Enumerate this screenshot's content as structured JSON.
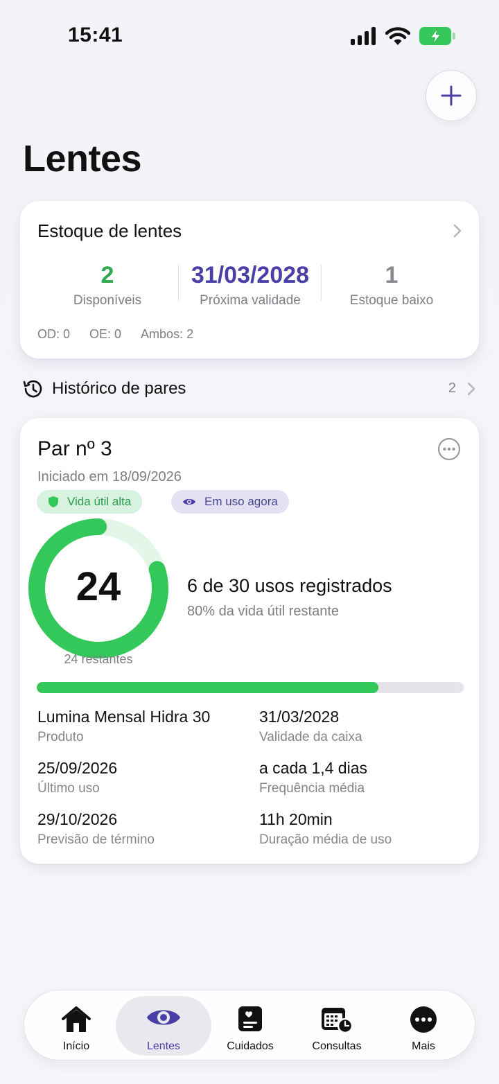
{
  "status": {
    "time": "15:41"
  },
  "colors": {
    "accent": "#4a3fa6",
    "green": "#34c759",
    "green_text": "#2fa84f",
    "muted": "#7d7d85"
  },
  "page": {
    "title": "Lentes"
  },
  "stock": {
    "title": "Estoque de lentes",
    "available": {
      "value": "2",
      "label": "Disponíveis"
    },
    "next_expiry": {
      "value": "31/03/2028",
      "label": "Próxima validade"
    },
    "low_stock": {
      "value": "1",
      "label": "Estoque baixo"
    },
    "od": "OD: 0",
    "oe": "OE: 0",
    "both": "Ambos: 2"
  },
  "history": {
    "label": "Histórico de pares",
    "count": "2"
  },
  "pair": {
    "title": "Par nº 3",
    "started": "Iniciado em 18/09/2026",
    "badge_life": "Vida útil alta",
    "badge_use": "Em uso agora",
    "remaining_number": "24",
    "remaining_label": "24 restantes",
    "uses_title": "6 de 30 usos registrados",
    "uses_sub": "80% da vida útil restante",
    "life_remaining_fraction": 0.8,
    "used_fraction": 0.2,
    "details": {
      "product_value": "Lumina Mensal Hidra 30",
      "product_label": "Produto",
      "box_expiry_value": "31/03/2028",
      "box_expiry_label": "Validade da caixa",
      "last_use_value": "25/09/2026",
      "last_use_label": "Último uso",
      "frequency_value": "a cada 1,4 dias",
      "frequency_label": "Frequência média",
      "end_forecast_value": "29/10/2026",
      "end_forecast_label": "Previsão de término",
      "avg_duration_value": "11h 20min",
      "avg_duration_label": "Duração média de uso"
    }
  },
  "tabs": [
    {
      "label": "Início",
      "icon": "house-icon"
    },
    {
      "label": "Lentes",
      "icon": "eye-icon",
      "active": true
    },
    {
      "label": "Cuidados",
      "icon": "care-card-icon"
    },
    {
      "label": "Consultas",
      "icon": "calendar-clock-icon"
    },
    {
      "label": "Mais",
      "icon": "more-icon"
    }
  ]
}
